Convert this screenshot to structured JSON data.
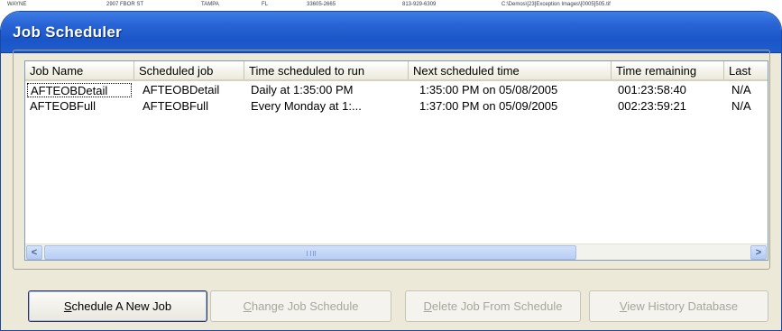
{
  "background": {
    "row": [
      "WAYNE",
      "2907 FBOR ST",
      "TAMPA",
      "FL",
      "33605-2665",
      "813-929-6309",
      "C:\\Demos\\[23]Exception Images\\[0005]505.tif"
    ]
  },
  "window": {
    "title": "Job Scheduler"
  },
  "list": {
    "columns": [
      "Job Name",
      "Scheduled job",
      "Time scheduled to run",
      "Next scheduled time",
      "Time remaining",
      "Last"
    ],
    "rows": [
      {
        "job_name": "AFTEOBDetail",
        "scheduled_job": "AFTEOBDetail",
        "time_to_run": "Daily at  1:35:00 PM",
        "next_time": "1:35:00 PM on 05/08/2005",
        "remaining": "001:23:58:40",
        "last": "N/A"
      },
      {
        "job_name": "AFTEOBFull",
        "scheduled_job": "AFTEOBFull",
        "time_to_run": "Every Monday at  1:...",
        "next_time": "1:37:00 PM on 05/09/2005",
        "remaining": "002:23:59:21",
        "last": "N/A"
      }
    ]
  },
  "scrollbar": {
    "left_arrow": "<",
    "right_arrow": ">"
  },
  "buttons": {
    "schedule_new": {
      "prefix": "S",
      "rest": "chedule A New Job"
    },
    "change": {
      "prefix": "C",
      "rest": "hange Job Schedule"
    },
    "delete": {
      "prefix": "D",
      "rest": "elete Job From Schedule"
    },
    "history": {
      "prefix": "V",
      "rest": "iew History Database"
    }
  }
}
